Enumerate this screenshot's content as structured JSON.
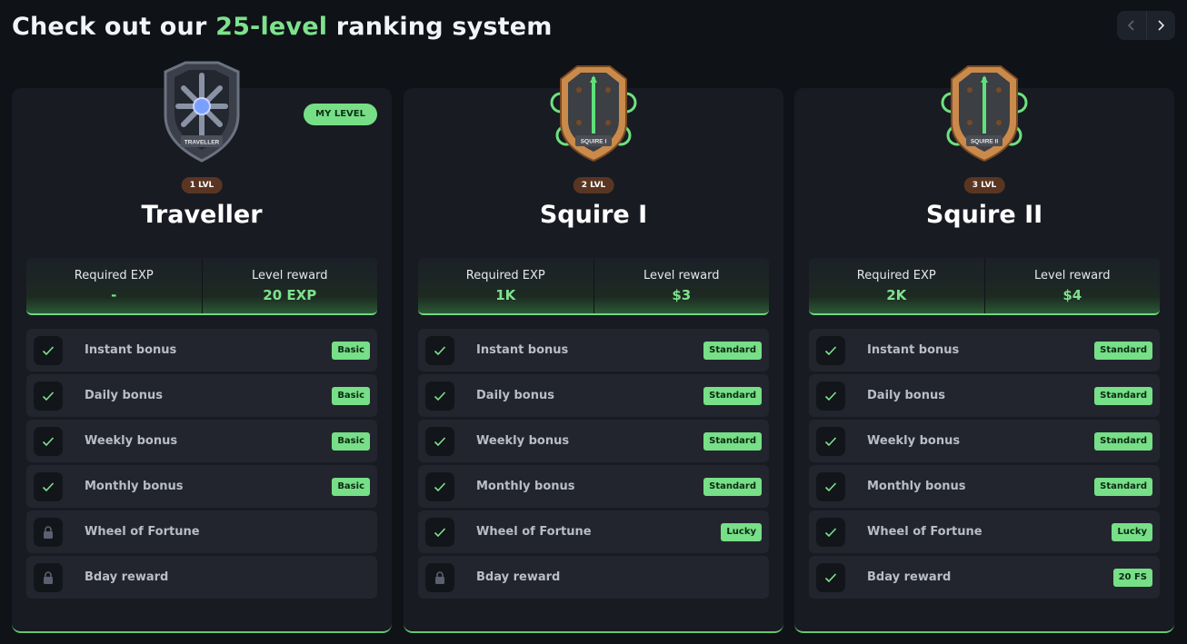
{
  "headline": {
    "prefix": "Check out our ",
    "highlight": "25-level",
    "suffix": " ranking system"
  },
  "nav": {
    "prev_icon": "chevron-left-icon",
    "next_icon": "chevron-right-icon"
  },
  "colors": {
    "accent": "#7ee28c",
    "tag_bg": "#77df87",
    "level_pill": "#5a3622",
    "card_bg": "#181b22"
  },
  "cards": [
    {
      "level_pill": "1 LVL",
      "name": "Traveller",
      "badge_text": "TRAVELLER",
      "badge_style": "silver-shield",
      "my_level": "MY LEVEL",
      "stats": [
        {
          "label": "Required EXP",
          "value": "-"
        },
        {
          "label": "Level reward",
          "value": "20 EXP"
        }
      ],
      "features": [
        {
          "label": "Instant bonus",
          "status": "check",
          "tag": "Basic"
        },
        {
          "label": "Daily bonus",
          "status": "check",
          "tag": "Basic"
        },
        {
          "label": "Weekly bonus",
          "status": "check",
          "tag": "Basic"
        },
        {
          "label": "Monthly bonus",
          "status": "check",
          "tag": "Basic"
        },
        {
          "label": "Wheel of Fortune",
          "status": "lock",
          "tag": ""
        },
        {
          "label": "Bday reward",
          "status": "lock",
          "tag": ""
        }
      ]
    },
    {
      "level_pill": "2 LVL",
      "name": "Squire I",
      "badge_text": "SQUIRE I",
      "badge_style": "bronze-shield",
      "my_level": "",
      "stats": [
        {
          "label": "Required EXP",
          "value": "1K"
        },
        {
          "label": "Level reward",
          "value": "$3"
        }
      ],
      "features": [
        {
          "label": "Instant bonus",
          "status": "check",
          "tag": "Standard"
        },
        {
          "label": "Daily bonus",
          "status": "check",
          "tag": "Standard"
        },
        {
          "label": "Weekly bonus",
          "status": "check",
          "tag": "Standard"
        },
        {
          "label": "Monthly bonus",
          "status": "check",
          "tag": "Standard"
        },
        {
          "label": "Wheel of Fortune",
          "status": "check",
          "tag": "Lucky"
        },
        {
          "label": "Bday reward",
          "status": "lock",
          "tag": ""
        }
      ]
    },
    {
      "level_pill": "3 LVL",
      "name": "Squire II",
      "badge_text": "SQUIRE II",
      "badge_style": "bronze-shield",
      "my_level": "",
      "stats": [
        {
          "label": "Required EXP",
          "value": "2K"
        },
        {
          "label": "Level reward",
          "value": "$4"
        }
      ],
      "features": [
        {
          "label": "Instant bonus",
          "status": "check",
          "tag": "Standard"
        },
        {
          "label": "Daily bonus",
          "status": "check",
          "tag": "Standard"
        },
        {
          "label": "Weekly bonus",
          "status": "check",
          "tag": "Standard"
        },
        {
          "label": "Monthly bonus",
          "status": "check",
          "tag": "Standard"
        },
        {
          "label": "Wheel of Fortune",
          "status": "check",
          "tag": "Lucky"
        },
        {
          "label": "Bday reward",
          "status": "check",
          "tag": "20 FS"
        }
      ]
    }
  ]
}
